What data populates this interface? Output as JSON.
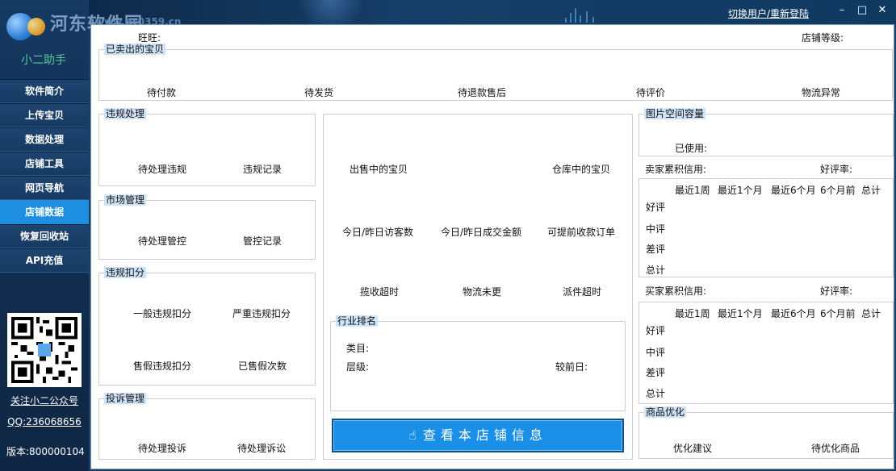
{
  "app": {
    "name": "小二助手",
    "watermark": "河东软件园",
    "watermark_url": "www.pc0359.cn"
  },
  "titlebar": {
    "switch_user": "切换用户/重新登陆",
    "minimize_icon": "–",
    "restore_icon": "□",
    "close_icon": "✕"
  },
  "sidebar": {
    "items": [
      {
        "label": "软件简介"
      },
      {
        "label": "上传宝贝"
      },
      {
        "label": "数据处理"
      },
      {
        "label": "店铺工具"
      },
      {
        "label": "网页导航"
      },
      {
        "label": "店铺数据",
        "active": true
      },
      {
        "label": "恢复回收站"
      },
      {
        "label": "API充值"
      }
    ],
    "follow": "关注小二公众号",
    "qq": "QQ:236068656",
    "version": "版本:800000104"
  },
  "header": {
    "wangwang": "旺旺:",
    "shop_level": "店铺等级:"
  },
  "sold": {
    "title": "已卖出的宝贝",
    "items": [
      "待付款",
      "待发货",
      "待退款售后",
      "待评价",
      "物流异常"
    ]
  },
  "violation": {
    "title": "违规处理",
    "items": [
      "待处理违规",
      "违规记录"
    ]
  },
  "market": {
    "title": "市场管理",
    "items": [
      "待处理管控",
      "管控记录"
    ]
  },
  "deduct": {
    "title": "违规扣分",
    "items": [
      "一般违规扣分",
      "严重违规扣分",
      "售假违规扣分",
      "已售假次数"
    ]
  },
  "complaint": {
    "title": "投诉管理",
    "items": [
      "待处理投诉",
      "待处理诉讼"
    ]
  },
  "center": {
    "row1": [
      "出售中的宝贝",
      "仓库中的宝贝"
    ],
    "row2": [
      "今日/昨日访客数",
      "今日/昨日成交金额",
      "可提前收款订单"
    ],
    "row3": [
      "揽收超时",
      "物流未更",
      "派件超时"
    ]
  },
  "ranking": {
    "title": "行业排名",
    "category": "类目:",
    "level": "层级:",
    "compare": "较前日:"
  },
  "main_button": {
    "label": "查看本店铺信息",
    "icon": "hand-pointer-icon"
  },
  "image_space": {
    "title": "图片空间容量",
    "used": "已使用:"
  },
  "seller_credit": {
    "label": "卖家累积信用:",
    "rate": "好评率:",
    "columns": [
      "最近1周",
      "最近1个月",
      "最近6个月",
      "6个月前",
      "总计"
    ],
    "rows": [
      "好评",
      "中评",
      "差评",
      "总计"
    ]
  },
  "buyer_credit": {
    "label": "买家累积信用:",
    "rate": "好评率:",
    "columns": [
      "最近1周",
      "最近1个月",
      "最近6个月",
      "6个月前",
      "总计"
    ],
    "rows": [
      "好评",
      "中评",
      "差评",
      "总计"
    ]
  },
  "optimize": {
    "title": "商品优化",
    "items": [
      "优化建议",
      "待优化商品"
    ]
  },
  "colors": {
    "accent": "#1e8fe0",
    "sidebar": "#163a63",
    "group_title_bg": "#cfe3f7"
  }
}
